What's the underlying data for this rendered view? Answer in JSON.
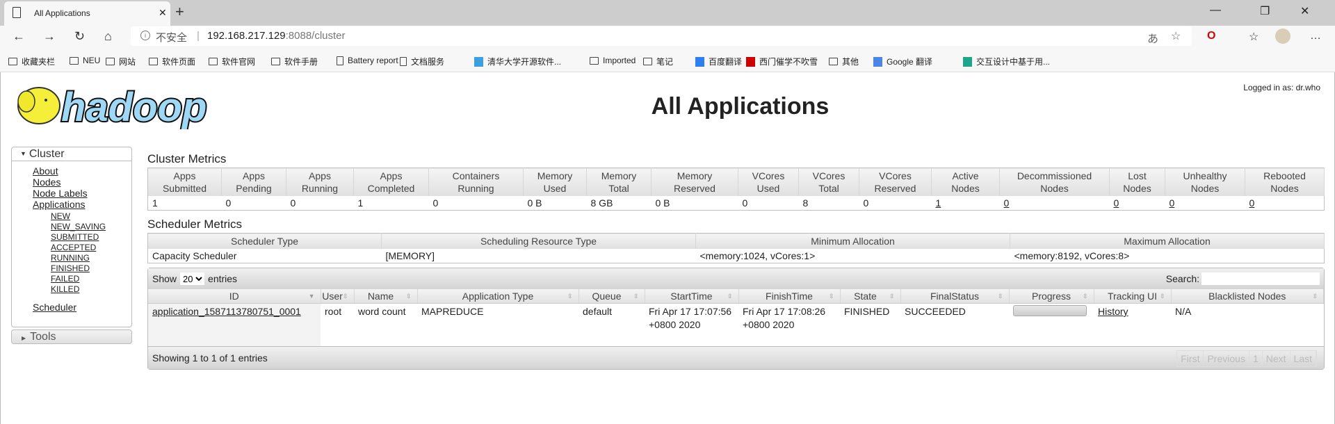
{
  "browser": {
    "tab_title": "All Applications",
    "not_secure": "不安全",
    "url_host": "192.168.217.129",
    "url_path": ":8088/cluster",
    "bookmarks": [
      {
        "label": "收藏夹栏",
        "icon": "folder"
      },
      {
        "label": "NEU",
        "icon": "folder"
      },
      {
        "label": "网站",
        "icon": "folder"
      },
      {
        "label": "软件页面",
        "icon": "folder"
      },
      {
        "label": "软件官网",
        "icon": "folder"
      },
      {
        "label": "软件手册",
        "icon": "folder"
      },
      {
        "label": "Battery report",
        "icon": "page"
      },
      {
        "label": "文档服务",
        "icon": "page"
      },
      {
        "label": "清华大学开源软件...",
        "icon": "tuna"
      },
      {
        "label": "Imported",
        "icon": "folder"
      },
      {
        "label": "笔记",
        "icon": "folder"
      },
      {
        "label": "百度翻译",
        "icon": "baidu-translate"
      },
      {
        "label": "西门催学不吹雪",
        "icon": "csdn"
      },
      {
        "label": "其他",
        "icon": "folder"
      },
      {
        "label": "Google 翻译",
        "icon": "google-translate"
      },
      {
        "label": "交互设计中基于用...",
        "icon": "doc"
      }
    ]
  },
  "header": {
    "logo": "hadoop",
    "title": "All Applications",
    "logged_in": "Logged in as: dr.who"
  },
  "sidebar": {
    "cluster_label": "Cluster",
    "links": [
      "About",
      "Nodes",
      "Node Labels",
      "Applications"
    ],
    "states": [
      "NEW",
      "NEW_SAVING",
      "SUBMITTED",
      "ACCEPTED",
      "RUNNING",
      "FINISHED",
      "FAILED",
      "KILLED"
    ],
    "scheduler": "Scheduler",
    "tools_label": "Tools"
  },
  "cluster_metrics": {
    "title": "Cluster Metrics",
    "headers": [
      [
        "Apps",
        "Submitted"
      ],
      [
        "Apps",
        "Pending"
      ],
      [
        "Apps",
        "Running"
      ],
      [
        "Apps",
        "Completed"
      ],
      [
        "Containers",
        "Running"
      ],
      [
        "Memory",
        "Used"
      ],
      [
        "Memory",
        "Total"
      ],
      [
        "Memory",
        "Reserved"
      ],
      [
        "VCores",
        "Used"
      ],
      [
        "VCores",
        "Total"
      ],
      [
        "VCores",
        "Reserved"
      ],
      [
        "Active",
        "Nodes"
      ],
      [
        "Decommissioned",
        "Nodes"
      ],
      [
        "Lost",
        "Nodes"
      ],
      [
        "Unhealthy",
        "Nodes"
      ],
      [
        "Rebooted",
        "Nodes"
      ]
    ],
    "values": [
      "1",
      "0",
      "0",
      "1",
      "0",
      "0 B",
      "8 GB",
      "0 B",
      "0",
      "8",
      "0",
      "1",
      "0",
      "0",
      "0",
      "0"
    ]
  },
  "scheduler_metrics": {
    "title": "Scheduler Metrics",
    "headers": [
      "Scheduler Type",
      "Scheduling Resource Type",
      "Minimum Allocation",
      "Maximum Allocation"
    ],
    "values": [
      "Capacity Scheduler",
      "[MEMORY]",
      "<memory:1024, vCores:1>",
      "<memory:8192, vCores:8>"
    ]
  },
  "apps": {
    "show_label": "Show",
    "entries_label": "entries",
    "page_size": "20",
    "search_label": "Search:",
    "search_value": "",
    "headers": [
      "ID",
      "User",
      "Name",
      "Application Type",
      "Queue",
      "StartTime",
      "FinishTime",
      "State",
      "FinalStatus",
      "Progress",
      "Tracking UI",
      "Blacklisted Nodes"
    ],
    "rows": [
      {
        "id": "application_1587113780751_0001",
        "user": "root",
        "name": "word count",
        "type": "MAPREDUCE",
        "queue": "default",
        "start": "Fri Apr 17 17:07:56 +0800 2020",
        "finish": "Fri Apr 17 17:08:26 +0800 2020",
        "state": "FINISHED",
        "final": "SUCCEEDED",
        "progress": 100,
        "tracking": "History",
        "blacklisted": "N/A"
      }
    ],
    "info": "Showing 1 to 1 of 1 entries",
    "pager": [
      "First",
      "Previous",
      "1",
      "Next",
      "Last"
    ]
  }
}
